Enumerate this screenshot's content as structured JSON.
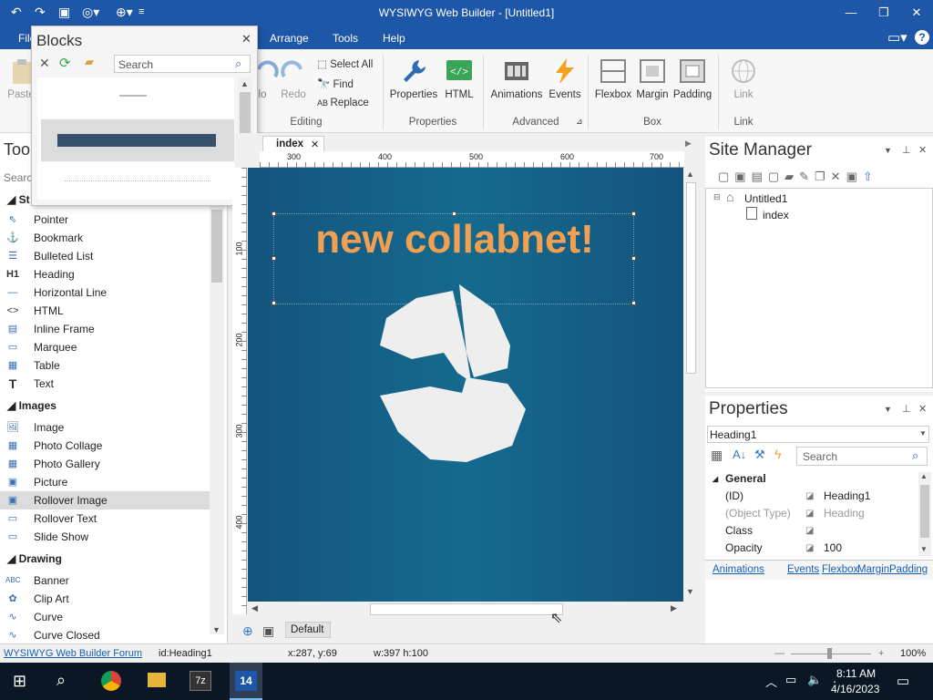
{
  "window": {
    "title": "WYSIWYG Web Builder - [Untitled1]"
  },
  "menu": {
    "items": [
      "File",
      "Arrange",
      "Tools",
      "Help"
    ]
  },
  "ribbon": {
    "paste": "Paste",
    "undo": "Undo",
    "redo": "Redo",
    "select_all": "Select All",
    "find": "Find",
    "replace": "Replace",
    "editing_group": "Editing",
    "properties": "Properties",
    "html": "HTML",
    "properties_group": "Properties",
    "animations": "Animations",
    "events": "Events",
    "advanced_group": "Advanced",
    "flexbox": "Flexbox",
    "margin": "Margin",
    "padding": "Padding",
    "box_group": "Box",
    "link": "Link",
    "link_group": "Link"
  },
  "blocks": {
    "title": "Blocks",
    "search_placeholder": "Search"
  },
  "toolbox": {
    "title": "Too",
    "search_placeholder": "Searc",
    "standard_cat": "St",
    "standard": [
      "Pointer",
      "Bookmark",
      "Bulleted List",
      "Heading",
      "Horizontal Line",
      "HTML",
      "Inline Frame",
      "Marquee",
      "Table",
      "Text"
    ],
    "images_cat": "Images",
    "images": [
      "Image",
      "Photo Collage",
      "Photo Gallery",
      "Picture",
      "Rollover Image",
      "Rollover Text",
      "Slide Show"
    ],
    "drawing_cat": "Drawing",
    "drawing": [
      "Banner",
      "Clip Art",
      "Curve",
      "Curve Closed"
    ]
  },
  "editor": {
    "tab": "index",
    "heading_text": "new collabnet!",
    "ruler_top": [
      "300",
      "400",
      "500",
      "600",
      "700"
    ],
    "ruler_left": [
      "100",
      "200",
      "300",
      "400"
    ],
    "default_label": "Default"
  },
  "site_manager": {
    "title": "Site Manager",
    "root": "Untitled1",
    "page": "index"
  },
  "properties": {
    "title": "Properties",
    "selected": "Heading1",
    "search_placeholder": "Search",
    "section": "General",
    "rows": [
      {
        "name": "(ID)",
        "value": "Heading1"
      },
      {
        "name": "(Object Type)",
        "value": "Heading"
      },
      {
        "name": "Class",
        "value": ""
      },
      {
        "name": "Opacity",
        "value": "100"
      }
    ],
    "links": [
      "Animations",
      "Events",
      "Flexbox",
      "Margin",
      "Padding"
    ]
  },
  "status": {
    "forum": "WYSIWYG Web Builder Forum",
    "id": "id:Heading1",
    "coords": "x:287, y:69",
    "size": "w:397 h:100",
    "zoom": "100%"
  },
  "taskbar": {
    "time": "8:11 AM",
    "date": "4/16/2023",
    "wb_label": "14"
  },
  "colors": {
    "titlebar": "#1e57a8",
    "heading": "#f0a050",
    "page_bg": "#15608a"
  }
}
